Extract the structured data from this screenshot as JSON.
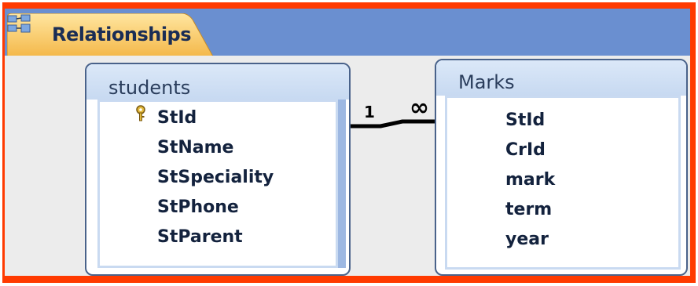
{
  "tab": {
    "label": "Relationships",
    "icon": "relationships-icon"
  },
  "tables": [
    {
      "name": "students",
      "fields": [
        {
          "name": "StId",
          "primary_key": true
        },
        {
          "name": "StName"
        },
        {
          "name": "StSpeciality"
        },
        {
          "name": "StPhone"
        },
        {
          "name": "StParent"
        }
      ]
    },
    {
      "name": "Marks",
      "fields": [
        {
          "name": "StId"
        },
        {
          "name": "CrId"
        },
        {
          "name": "mark"
        },
        {
          "name": "term"
        },
        {
          "name": "year"
        }
      ]
    }
  ],
  "relationship": {
    "one_label": "1",
    "many_label": "∞"
  },
  "colors": {
    "frame": "#ff3a00",
    "tab_strip": "#6a8fd0",
    "tab": "#f6c65a",
    "canvas": "#ececec"
  }
}
